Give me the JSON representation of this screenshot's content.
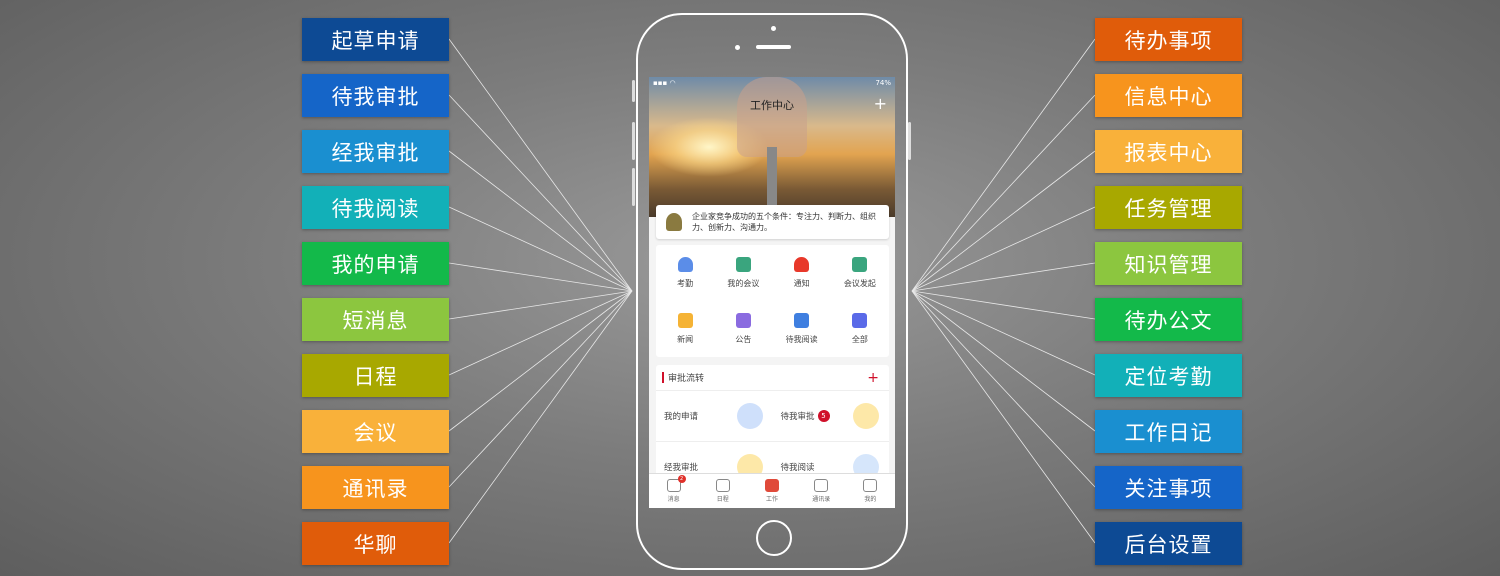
{
  "left_features": [
    {
      "label": "起草申请",
      "color": "#0d4a94"
    },
    {
      "label": "待我审批",
      "color": "#1565c8"
    },
    {
      "label": "经我审批",
      "color": "#1a8fd0"
    },
    {
      "label": "待我阅读",
      "color": "#12b0b8"
    },
    {
      "label": "我的申请",
      "color": "#13b94a"
    },
    {
      "label": "短消息",
      "color": "#8cc63f"
    },
    {
      "label": "日程",
      "color": "#a8a800"
    },
    {
      "label": "会议",
      "color": "#f9b13a"
    },
    {
      "label": "通讯录",
      "color": "#f7941d"
    },
    {
      "label": "华聊",
      "color": "#e05c0a"
    }
  ],
  "right_features": [
    {
      "label": "待办事项",
      "color": "#e05c0a"
    },
    {
      "label": "信息中心",
      "color": "#f7941d"
    },
    {
      "label": "报表中心",
      "color": "#f9b13a"
    },
    {
      "label": "任务管理",
      "color": "#a8a800"
    },
    {
      "label": "知识管理",
      "color": "#8cc63f"
    },
    {
      "label": "待办公文",
      "color": "#13b94a"
    },
    {
      "label": "定位考勤",
      "color": "#12b0b8"
    },
    {
      "label": "工作日记",
      "color": "#1a8fd0"
    },
    {
      "label": "关注事项",
      "color": "#1565c8"
    },
    {
      "label": "后台设置",
      "color": "#0d4a94"
    }
  ],
  "app": {
    "status_battery": "74%",
    "title": "工作中心",
    "notice": "企业家竞争成功的五个条件：专注力、判断力、组织力、创新力、沟通力。",
    "grid": [
      {
        "label": "考勤",
        "icon": "fingerprint-icon",
        "color": "#5b8de8"
      },
      {
        "label": "我的会议",
        "icon": "calendar-icon",
        "color": "#3aa57e"
      },
      {
        "label": "通知",
        "icon": "bell-icon",
        "color": "#e8382a"
      },
      {
        "label": "会议发起",
        "icon": "meeting-icon",
        "color": "#3aa57e"
      },
      {
        "label": "新闻",
        "icon": "news-icon",
        "color": "#f5b335"
      },
      {
        "label": "公告",
        "icon": "megaphone-icon",
        "color": "#8a6be0"
      },
      {
        "label": "待我阅读",
        "icon": "doc-search-icon",
        "color": "#3f7fe0"
      },
      {
        "label": "全部",
        "icon": "grid-icon",
        "color": "#5a6ae8"
      }
    ],
    "flow_title": "审批流转",
    "flow": [
      {
        "label": "我的申请",
        "icon_color": "#cfe0fb"
      },
      {
        "label": "待我审批",
        "badge": "5",
        "icon_color": "#fde8a8"
      },
      {
        "label": "经我审批",
        "icon_color": "#fde8a8"
      },
      {
        "label": "待我阅读",
        "icon_color": "#d6e6fb"
      }
    ],
    "tabs": [
      {
        "label": "消息",
        "badge": "2"
      },
      {
        "label": "日程"
      },
      {
        "label": "工作",
        "active": true
      },
      {
        "label": "通讯录"
      },
      {
        "label": "我的"
      }
    ]
  }
}
